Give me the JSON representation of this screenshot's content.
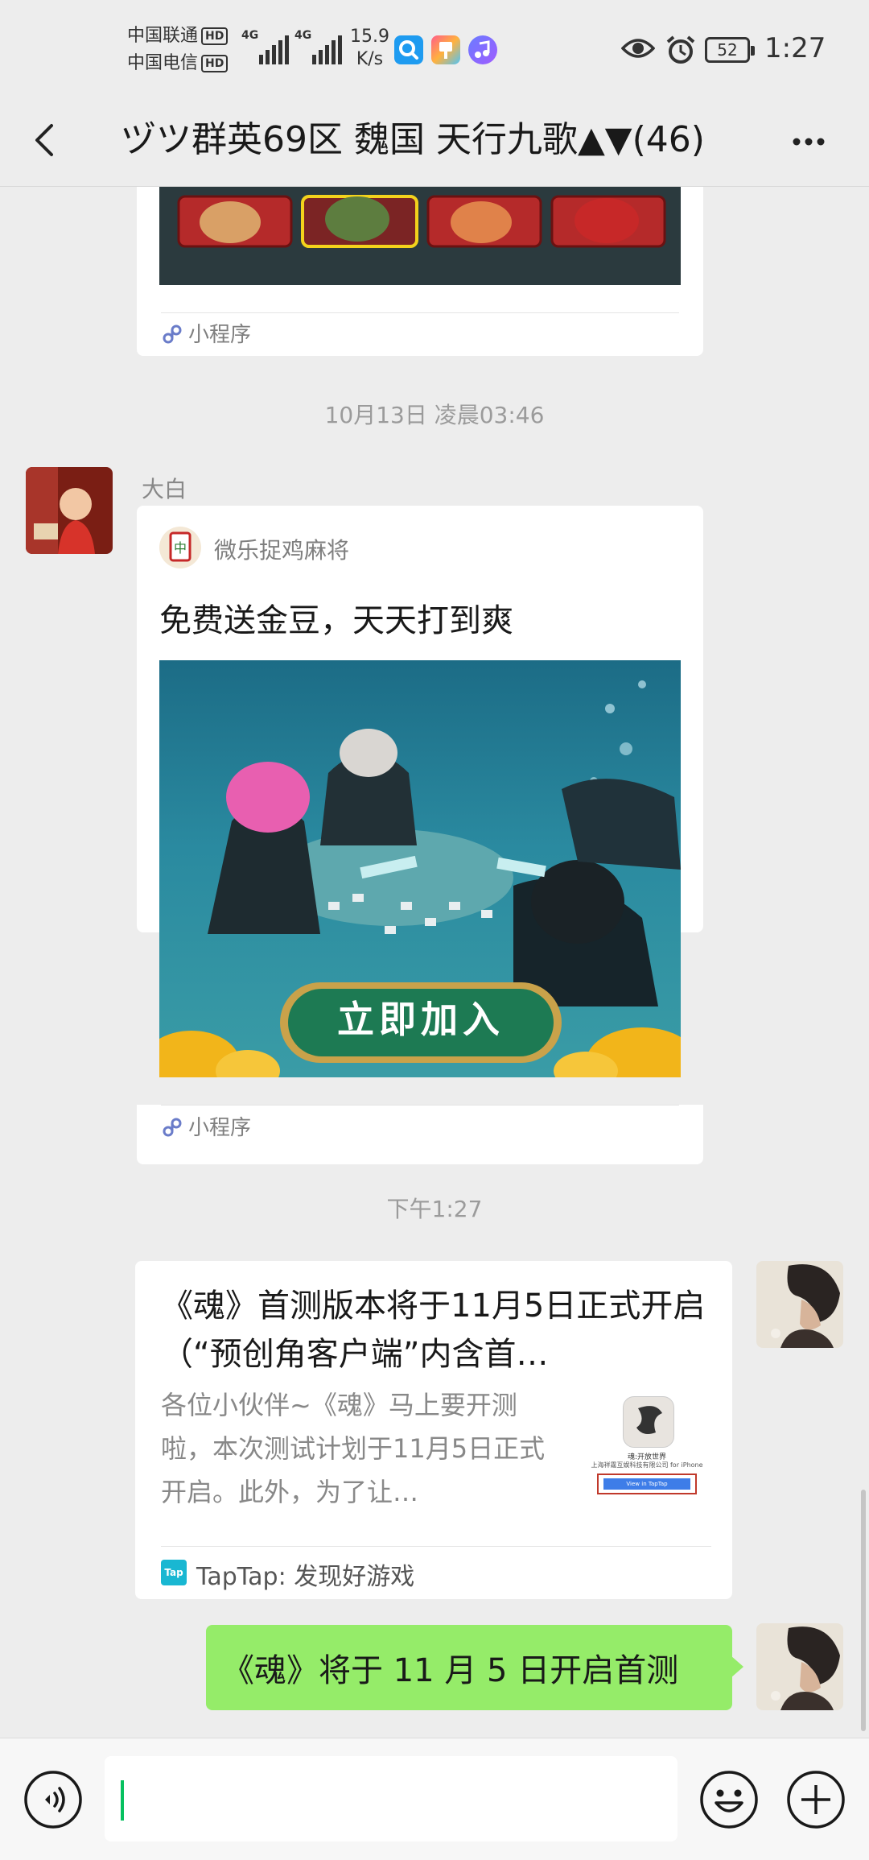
{
  "status_bar": {
    "carrier1": "中国联通",
    "carrier2": "中国电信",
    "hd_badge": "HD",
    "net_type": "4G",
    "speed_value": "15.9",
    "speed_unit": "K/s",
    "battery": "52",
    "time": "1:27"
  },
  "header": {
    "title": "ヅツ群英69区 魏国 天行九歌▲▼(46)"
  },
  "messages": {
    "card1": {
      "footer": "小程序"
    },
    "time1": "10月13日 凌晨03:46",
    "msg2": {
      "sender": "大白",
      "app_name": "微乐捉鸡麻将",
      "title": "免费送金豆，天天打到爽",
      "button_text": "立即加入",
      "footer": "小程序"
    },
    "time2": "下午1:27",
    "msg3": {
      "title": "《魂》首测版本将于11月5日正式开启（“预创角客户端”内含首…",
      "desc": "各位小伙伴~《魂》马上要开测啦，本次测试计划于11月5日正式开启。此外，为了让…",
      "thumb_line1": "魂:开放世界",
      "thumb_line2": "上海祥霆互娱科技有限公司 for iPhone",
      "thumb_button": "View in TapTap",
      "source_icon": "Tap",
      "source": "TapTap: 发现好游戏"
    },
    "msg4": {
      "text": "《魂》将于 11 月 5 日开启首测"
    }
  },
  "colors": {
    "bg": "#ededed",
    "bubble_green": "#95ec69",
    "card_white": "#ffffff",
    "cursor": "#07c160",
    "taptap": "#19b7d2"
  },
  "icons": [
    "back-arrow-icon",
    "more-icon",
    "miniprogram-icon",
    "voice-icon",
    "emoji-icon",
    "plus-icon"
  ]
}
